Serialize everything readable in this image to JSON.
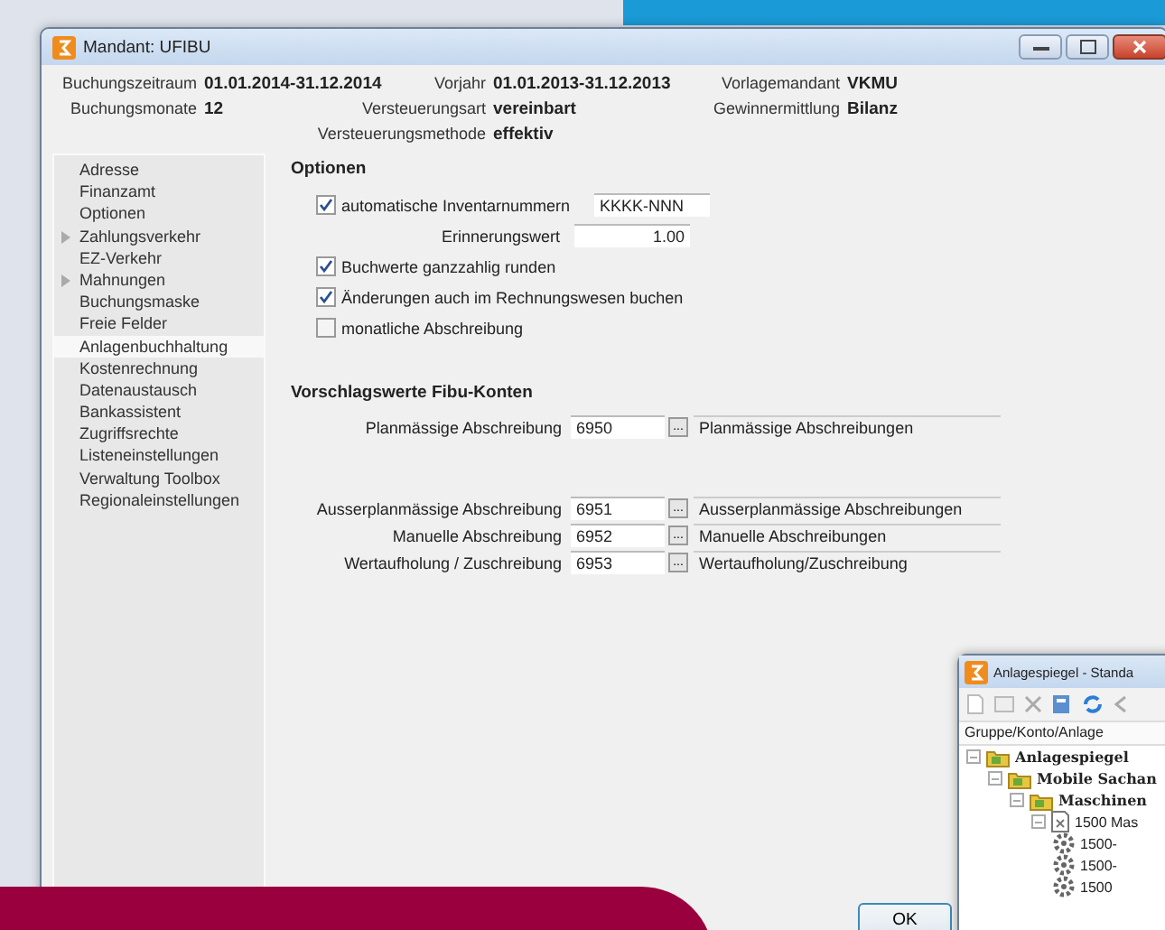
{
  "window": {
    "title": "Mandant: UFIBU"
  },
  "summary": [
    {
      "label": "Buchungszeitraum",
      "value": "01.01.2014-31.12.2014"
    },
    {
      "label": "Vorjahr",
      "value": "01.01.2013-31.12.2013"
    },
    {
      "label": "Vorlagemandant",
      "value": "VKMU"
    },
    {
      "label": "Buchungsmonate",
      "value": "12"
    },
    {
      "label": "Versteuerungsart",
      "value": "vereinbart"
    },
    {
      "label": "Gewinnermittlung",
      "value": "Bilanz"
    },
    {
      "label": "Versteuerungsmethode",
      "value": "effektiv"
    }
  ],
  "sidebar": {
    "items": [
      {
        "label": "Adresse",
        "expandable": false,
        "selected": false
      },
      {
        "label": "Finanzamt",
        "expandable": false,
        "selected": false
      },
      {
        "label": "Optionen",
        "expandable": false,
        "selected": false
      },
      {
        "label": "Zahlungsverkehr",
        "expandable": true,
        "selected": false
      },
      {
        "label": "EZ-Verkehr",
        "expandable": false,
        "selected": false
      },
      {
        "label": "Mahnungen",
        "expandable": true,
        "selected": false
      },
      {
        "label": "Buchungsmaske",
        "expandable": false,
        "selected": false
      },
      {
        "label": "Freie Felder",
        "expandable": false,
        "selected": false
      },
      {
        "label": "Anlagenbuchhaltung",
        "expandable": false,
        "selected": true
      },
      {
        "label": "Kostenrechnung",
        "expandable": false,
        "selected": false
      },
      {
        "label": "Datenaustausch",
        "expandable": false,
        "selected": false
      },
      {
        "label": "Bankassistent",
        "expandable": false,
        "selected": false
      },
      {
        "label": "Zugriffsrechte",
        "expandable": false,
        "selected": false
      },
      {
        "label": "Listeneinstellungen",
        "expandable": false,
        "selected": false
      },
      {
        "label": "Verwaltung Toolbox",
        "expandable": false,
        "selected": false
      },
      {
        "label": "Regionaleinstellungen",
        "expandable": false,
        "selected": false
      }
    ]
  },
  "options": {
    "title": "Optionen",
    "items": [
      {
        "kind": "checkbox",
        "label": "automatische Inventarnummern",
        "checked": true,
        "value": "KKKK-NNN"
      },
      {
        "kind": "number",
        "label": "Erinnerungswert",
        "value": "1.00"
      },
      {
        "kind": "checkbox",
        "label": "Buchwerte ganzzahlig runden",
        "checked": true
      },
      {
        "kind": "checkbox",
        "label": "Änderungen auch im Rechnungswesen buchen",
        "checked": true
      },
      {
        "kind": "checkbox",
        "label": "monatliche Abschreibung",
        "checked": false
      }
    ]
  },
  "accounts": {
    "title": "Vorschlagswerte Fibu-Konten",
    "groups": [
      [
        {
          "label": "Planmässige Abschreibung",
          "account": "6950",
          "button": "...",
          "name": "Planmässige Abschreibungen"
        }
      ],
      [
        {
          "label": "Ausserplanmässige Abschreibung",
          "account": "6951",
          "button": "...",
          "name": "Ausserplanmässige Abschreibungen"
        },
        {
          "label": "Manuelle Abschreibung",
          "account": "6952",
          "button": "...",
          "name": "Manuelle Abschreibungen"
        },
        {
          "label": "Wertaufholung / Zuschreibung",
          "account": "6953",
          "button": "...",
          "name": "Wertaufholung/Zuschreibung"
        }
      ]
    ]
  },
  "ok_button": "OK",
  "second_window": {
    "title": "Anlagespiegel - Standa",
    "column": "Gruppe/Konto/Anlage",
    "tree": [
      {
        "label": "Anlagespiegel",
        "kind": "folder",
        "children": [
          {
            "label": "Mobile Sachan",
            "kind": "folder",
            "children": [
              {
                "label": "Maschinen",
                "kind": "folder",
                "children": [
                  {
                    "label": "1500 Mas",
                    "kind": "document",
                    "children": [
                      {
                        "label": "1500-",
                        "kind": "gear"
                      },
                      {
                        "label": "1500-",
                        "kind": "gear"
                      },
                      {
                        "label": "1500",
                        "kind": "gear"
                      }
                    ]
                  }
                ]
              }
            ]
          }
        ]
      }
    ]
  }
}
